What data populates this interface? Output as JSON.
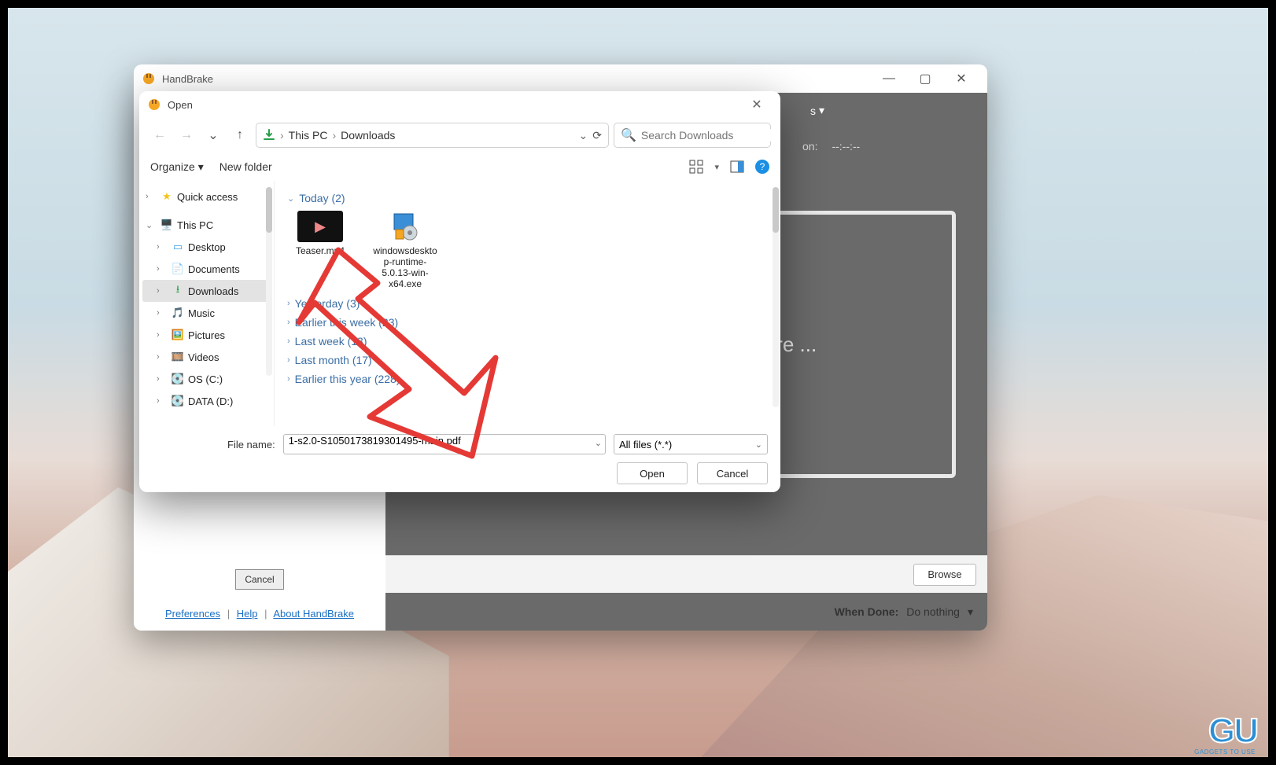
{
  "handbrake": {
    "title": "HandBrake",
    "dark_top_right_label": "s",
    "dark_line2_label": "on:",
    "dark_line2_value": "--:--:--",
    "dropzone_text": "ere ...",
    "browse_label": "Browse",
    "when_done_label": "When Done:",
    "when_done_value": "Do nothing",
    "source_cancel": "Cancel",
    "footer_links": {
      "pref": "Preferences",
      "help": "Help",
      "about": "About HandBrake"
    }
  },
  "dialog": {
    "title": "Open",
    "breadcrumbs": [
      "This PC",
      "Downloads"
    ],
    "search_placeholder": "Search Downloads",
    "toolbar": {
      "organize": "Organize",
      "new_folder": "New folder"
    },
    "tree": {
      "quick_access": "Quick access",
      "this_pc": "This PC",
      "desktop": "Desktop",
      "documents": "Documents",
      "downloads": "Downloads",
      "music": "Music",
      "pictures": "Pictures",
      "videos": "Videos",
      "os_c": "OS (C:)",
      "data_d": "DATA (D:)"
    },
    "groups": [
      {
        "label": "Today",
        "count": 2,
        "expanded": true,
        "files": [
          {
            "name": "Teaser.mp4",
            "kind": "video"
          },
          {
            "name": "windowsdesktop-runtime-5.0.13-win-x64.exe",
            "kind": "exe"
          }
        ]
      },
      {
        "label": "Yesterday",
        "count": 3,
        "expanded": false
      },
      {
        "label": "Earlier this week",
        "count": 23,
        "expanded": false
      },
      {
        "label": "Last week",
        "count": 13,
        "expanded": false
      },
      {
        "label": "Last month",
        "count": 17,
        "expanded": false
      },
      {
        "label": "Earlier this year",
        "count": 228,
        "expanded": false
      }
    ],
    "file_name_label": "File name:",
    "file_name_value": "1-s2.0-S1050173819301495-main.pdf",
    "type_filter": "All files (*.*)",
    "open_btn": "Open",
    "cancel_btn": "Cancel"
  },
  "watermark": {
    "logo": "GU",
    "sub": "GADGETS TO USE"
  }
}
